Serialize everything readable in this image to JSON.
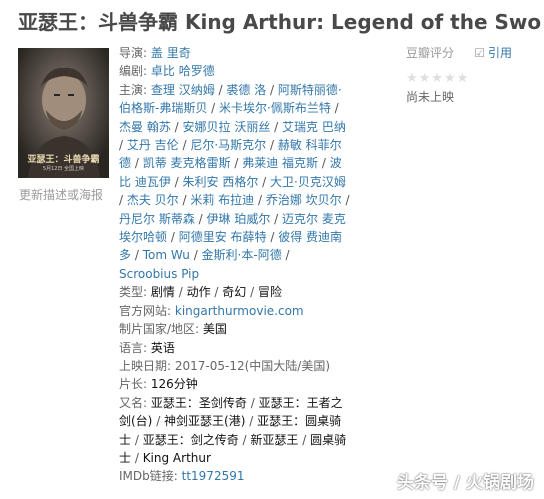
{
  "header": {
    "title": "亚瑟王：斗兽争霸 King Arthur: Legend of the Swo"
  },
  "poster": {
    "title_text": "亚瑟王：斗兽争霸",
    "date_text": "5月12日 全国上映",
    "more_link": "更新描述或海报"
  },
  "rating": {
    "label": "豆瓣评分",
    "cite_label": "引用",
    "stars": "★★★★★",
    "status": "尚未上映"
  },
  "info": {
    "director_label": "导演:",
    "directors": [
      "盖 里奇"
    ],
    "writer_label": "编剧:",
    "writers": [
      "卓比 哈罗德"
    ],
    "cast_label": "主演:",
    "cast": [
      "查理 汉纳姆",
      "裘德 洛",
      "阿斯特丽德·伯格斯-弗瑞斯贝",
      "米卡埃尔·佩斯布兰特",
      "杰曼 翰苏",
      "安娜贝拉 沃丽丝",
      "艾瑞克 巴纳",
      "艾丹 吉伦",
      "尼尔·马斯克尔",
      "赫敏 科菲尔德",
      "凯蒂 麦克格雷斯",
      "弗莱迪 福克斯",
      "波比 迪瓦伊",
      "朱利安 西格尔",
      "大卫·贝克汉姆",
      "杰夫 贝尔",
      "米莉 布拉迪",
      "乔治娜 坎贝尔",
      "丹尼尔 斯蒂森",
      "伊琳 珀威尔",
      "迈克尔 麦克埃尔哈顿",
      "阿德里安 布薛特",
      "彼得 费迪南多",
      "Tom Wu",
      "金斯利·本-阿德",
      "Scroobius Pip"
    ],
    "genre_label": "类型:",
    "genres": [
      "剧情",
      "动作",
      "奇幻",
      "冒险"
    ],
    "site_label": "官方网站:",
    "site": "kingarthurmovie.com",
    "country_label": "制片国家/地区:",
    "country": "美国",
    "language_label": "语言:",
    "language": "英语",
    "release_label": "上映日期:",
    "release": "2017-05-12(中国大陆/美国)",
    "runtime_label": "片长:",
    "runtime": "126分钟",
    "aka_label": "又名:",
    "aka": [
      "亚瑟王：圣剑传奇",
      "亚瑟王：王者之剑(台)",
      "神剑亚瑟王(港)",
      "亚瑟王：圆桌骑士",
      "亚瑟王：剑之传奇",
      "新亚瑟王",
      "圆桌骑士",
      "King Arthur"
    ],
    "imdb_label": "IMDb链接:",
    "imdb": "tt1972591"
  },
  "watermark": "头条号 / 火锅剧场",
  "colors": {
    "link": "#3377aa",
    "label": "#666666",
    "title": "#494949",
    "star_empty": "#dedede"
  }
}
